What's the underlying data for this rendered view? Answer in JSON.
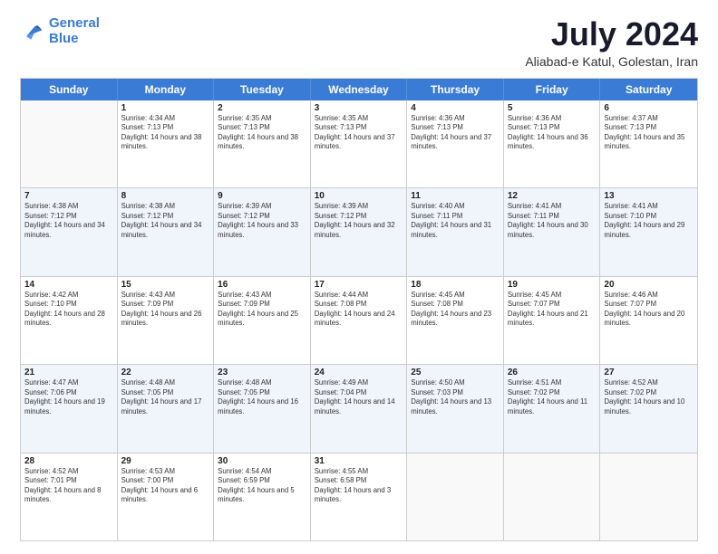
{
  "logo": {
    "line1": "General",
    "line2": "Blue"
  },
  "title": "July 2024",
  "location": "Aliabad-e Katul, Golestan, Iran",
  "header_days": [
    "Sunday",
    "Monday",
    "Tuesday",
    "Wednesday",
    "Thursday",
    "Friday",
    "Saturday"
  ],
  "weeks": [
    [
      {
        "day": "",
        "empty": true
      },
      {
        "day": "1",
        "sunrise": "Sunrise: 4:34 AM",
        "sunset": "Sunset: 7:13 PM",
        "daylight": "Daylight: 14 hours and 38 minutes."
      },
      {
        "day": "2",
        "sunrise": "Sunrise: 4:35 AM",
        "sunset": "Sunset: 7:13 PM",
        "daylight": "Daylight: 14 hours and 38 minutes."
      },
      {
        "day": "3",
        "sunrise": "Sunrise: 4:35 AM",
        "sunset": "Sunset: 7:13 PM",
        "daylight": "Daylight: 14 hours and 37 minutes."
      },
      {
        "day": "4",
        "sunrise": "Sunrise: 4:36 AM",
        "sunset": "Sunset: 7:13 PM",
        "daylight": "Daylight: 14 hours and 37 minutes."
      },
      {
        "day": "5",
        "sunrise": "Sunrise: 4:36 AM",
        "sunset": "Sunset: 7:13 PM",
        "daylight": "Daylight: 14 hours and 36 minutes."
      },
      {
        "day": "6",
        "sunrise": "Sunrise: 4:37 AM",
        "sunset": "Sunset: 7:13 PM",
        "daylight": "Daylight: 14 hours and 35 minutes."
      }
    ],
    [
      {
        "day": "7",
        "sunrise": "Sunrise: 4:38 AM",
        "sunset": "Sunset: 7:12 PM",
        "daylight": "Daylight: 14 hours and 34 minutes."
      },
      {
        "day": "8",
        "sunrise": "Sunrise: 4:38 AM",
        "sunset": "Sunset: 7:12 PM",
        "daylight": "Daylight: 14 hours and 34 minutes."
      },
      {
        "day": "9",
        "sunrise": "Sunrise: 4:39 AM",
        "sunset": "Sunset: 7:12 PM",
        "daylight": "Daylight: 14 hours and 33 minutes."
      },
      {
        "day": "10",
        "sunrise": "Sunrise: 4:39 AM",
        "sunset": "Sunset: 7:12 PM",
        "daylight": "Daylight: 14 hours and 32 minutes."
      },
      {
        "day": "11",
        "sunrise": "Sunrise: 4:40 AM",
        "sunset": "Sunset: 7:11 PM",
        "daylight": "Daylight: 14 hours and 31 minutes."
      },
      {
        "day": "12",
        "sunrise": "Sunrise: 4:41 AM",
        "sunset": "Sunset: 7:11 PM",
        "daylight": "Daylight: 14 hours and 30 minutes."
      },
      {
        "day": "13",
        "sunrise": "Sunrise: 4:41 AM",
        "sunset": "Sunset: 7:10 PM",
        "daylight": "Daylight: 14 hours and 29 minutes."
      }
    ],
    [
      {
        "day": "14",
        "sunrise": "Sunrise: 4:42 AM",
        "sunset": "Sunset: 7:10 PM",
        "daylight": "Daylight: 14 hours and 28 minutes."
      },
      {
        "day": "15",
        "sunrise": "Sunrise: 4:43 AM",
        "sunset": "Sunset: 7:09 PM",
        "daylight": "Daylight: 14 hours and 26 minutes."
      },
      {
        "day": "16",
        "sunrise": "Sunrise: 4:43 AM",
        "sunset": "Sunset: 7:09 PM",
        "daylight": "Daylight: 14 hours and 25 minutes."
      },
      {
        "day": "17",
        "sunrise": "Sunrise: 4:44 AM",
        "sunset": "Sunset: 7:08 PM",
        "daylight": "Daylight: 14 hours and 24 minutes."
      },
      {
        "day": "18",
        "sunrise": "Sunrise: 4:45 AM",
        "sunset": "Sunset: 7:08 PM",
        "daylight": "Daylight: 14 hours and 23 minutes."
      },
      {
        "day": "19",
        "sunrise": "Sunrise: 4:45 AM",
        "sunset": "Sunset: 7:07 PM",
        "daylight": "Daylight: 14 hours and 21 minutes."
      },
      {
        "day": "20",
        "sunrise": "Sunrise: 4:46 AM",
        "sunset": "Sunset: 7:07 PM",
        "daylight": "Daylight: 14 hours and 20 minutes."
      }
    ],
    [
      {
        "day": "21",
        "sunrise": "Sunrise: 4:47 AM",
        "sunset": "Sunset: 7:06 PM",
        "daylight": "Daylight: 14 hours and 19 minutes."
      },
      {
        "day": "22",
        "sunrise": "Sunrise: 4:48 AM",
        "sunset": "Sunset: 7:05 PM",
        "daylight": "Daylight: 14 hours and 17 minutes."
      },
      {
        "day": "23",
        "sunrise": "Sunrise: 4:48 AM",
        "sunset": "Sunset: 7:05 PM",
        "daylight": "Daylight: 14 hours and 16 minutes."
      },
      {
        "day": "24",
        "sunrise": "Sunrise: 4:49 AM",
        "sunset": "Sunset: 7:04 PM",
        "daylight": "Daylight: 14 hours and 14 minutes."
      },
      {
        "day": "25",
        "sunrise": "Sunrise: 4:50 AM",
        "sunset": "Sunset: 7:03 PM",
        "daylight": "Daylight: 14 hours and 13 minutes."
      },
      {
        "day": "26",
        "sunrise": "Sunrise: 4:51 AM",
        "sunset": "Sunset: 7:02 PM",
        "daylight": "Daylight: 14 hours and 11 minutes."
      },
      {
        "day": "27",
        "sunrise": "Sunrise: 4:52 AM",
        "sunset": "Sunset: 7:02 PM",
        "daylight": "Daylight: 14 hours and 10 minutes."
      }
    ],
    [
      {
        "day": "28",
        "sunrise": "Sunrise: 4:52 AM",
        "sunset": "Sunset: 7:01 PM",
        "daylight": "Daylight: 14 hours and 8 minutes."
      },
      {
        "day": "29",
        "sunrise": "Sunrise: 4:53 AM",
        "sunset": "Sunset: 7:00 PM",
        "daylight": "Daylight: 14 hours and 6 minutes."
      },
      {
        "day": "30",
        "sunrise": "Sunrise: 4:54 AM",
        "sunset": "Sunset: 6:59 PM",
        "daylight": "Daylight: 14 hours and 5 minutes."
      },
      {
        "day": "31",
        "sunrise": "Sunrise: 4:55 AM",
        "sunset": "Sunset: 6:58 PM",
        "daylight": "Daylight: 14 hours and 3 minutes."
      },
      {
        "day": "",
        "empty": true
      },
      {
        "day": "",
        "empty": true
      },
      {
        "day": "",
        "empty": true
      }
    ]
  ]
}
